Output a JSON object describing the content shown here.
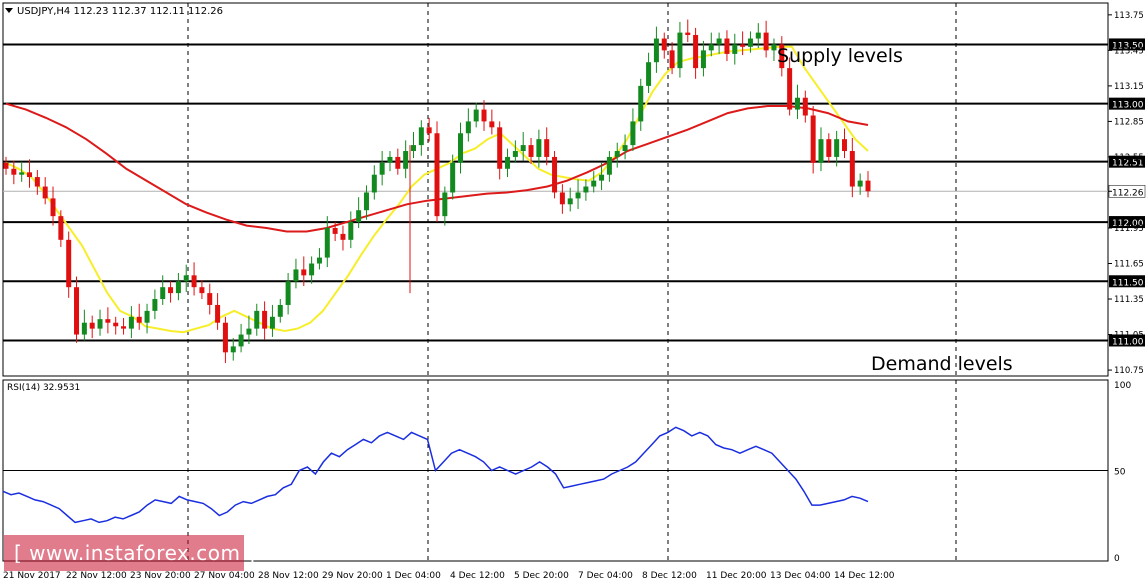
{
  "header": {
    "symbol_line": "USDJPY,H4  112.23 112.37 112.11 112.26",
    "menu_icon": "triangle-down-icon"
  },
  "annotations": {
    "supply": "Supply levels",
    "demand": "Demand levels"
  },
  "indicator": {
    "label": "RSI(14) 32.9531"
  },
  "watermark": "[ www.instaforex.com ]",
  "colors": {
    "bull": "#138a1f",
    "bear": "#e01010",
    "ma_fast": "#f7ee2a",
    "ma_slow": "#dd1a1a",
    "rsi": "#1a2ee0",
    "grid": "#000000"
  },
  "chart_data": [
    {
      "type": "candlestick",
      "symbol": "USDJPY",
      "timeframe": "H4",
      "ylim": [
        110.7,
        113.85
      ],
      "y_ticks": [
        "113.75",
        "113.45",
        "113.15",
        "112.85",
        "112.55",
        "112.26",
        "111.95",
        "111.65",
        "111.35",
        "111.05",
        "110.75"
      ],
      "x_labels": [
        "21 Nov 2017",
        "22 Nov 12:00",
        "23 Nov 20:00",
        "27 Nov 04:00",
        "28 Nov 12:00",
        "29 Nov 20:00",
        "1 Dec 04:00",
        "4 Dec 12:00",
        "5 Dec 20:00",
        "7 Dec 04:00",
        "8 Dec 12:00",
        "11 Dec 20:00",
        "13 Dec 04:00",
        "14 Dec 12:00"
      ],
      "horizontal_levels": [
        {
          "value": 113.5,
          "label": "113.50"
        },
        {
          "value": 113.0,
          "label": "113.00"
        },
        {
          "value": 112.51,
          "label": "112.51"
        },
        {
          "value": 112.0,
          "label": "112.00"
        },
        {
          "value": 111.5,
          "label": "111.50"
        },
        {
          "value": 111.0,
          "label": "111.00"
        }
      ],
      "current_price": {
        "value": 112.26,
        "label": "112.26"
      },
      "close_series": [
        112.45,
        112.4,
        112.42,
        112.38,
        112.3,
        112.2,
        112.05,
        111.85,
        111.45,
        111.05,
        111.15,
        111.1,
        111.18,
        111.15,
        111.12,
        111.1,
        111.2,
        111.15,
        111.25,
        111.35,
        111.45,
        111.4,
        111.5,
        111.55,
        111.45,
        111.4,
        111.3,
        111.15,
        110.9,
        110.95,
        111.05,
        111.1,
        111.25,
        111.1,
        111.2,
        111.3,
        111.5,
        111.6,
        111.55,
        111.65,
        111.7,
        111.95,
        111.9,
        111.85,
        112.0,
        112.1,
        112.25,
        112.4,
        112.5,
        112.55,
        112.45,
        112.6,
        112.65,
        112.8,
        112.75,
        112.05,
        112.25,
        112.5,
        112.75,
        112.85,
        112.95,
        112.85,
        112.8,
        112.45,
        112.55,
        112.6,
        112.65,
        112.55,
        112.7,
        112.55,
        112.25,
        112.15,
        112.2,
        112.25,
        112.3,
        112.35,
        112.4,
        112.55,
        112.6,
        112.65,
        112.85,
        113.15,
        113.35,
        113.55,
        113.45,
        113.3,
        113.6,
        113.58,
        113.3,
        113.45,
        113.5,
        113.55,
        113.42,
        113.5,
        113.48,
        113.55,
        113.6,
        113.45,
        113.5,
        113.3,
        112.95,
        113.05,
        112.9,
        112.5,
        112.7,
        112.55,
        112.7,
        112.6,
        112.3,
        112.35,
        112.26
      ],
      "series": [
        {
          "name": "",
          "style": "ma_fast",
          "values": [
            112.5,
            112.45,
            112.38,
            112.25,
            112.1,
            111.95,
            111.8,
            111.6,
            111.4,
            111.25,
            111.2,
            111.12,
            111.1,
            111.08,
            111.07,
            111.1,
            111.13,
            111.2,
            111.25,
            111.2,
            111.15,
            111.1,
            111.08,
            111.1,
            111.15,
            111.25,
            111.4,
            111.55,
            111.72,
            111.88,
            112.02,
            112.15,
            112.3,
            112.4,
            112.45,
            112.5,
            112.58,
            112.62,
            112.7,
            112.75,
            112.65,
            112.55,
            112.45,
            112.4,
            112.38,
            112.36,
            112.35,
            112.42,
            112.55,
            112.7,
            112.9,
            113.1,
            113.25,
            113.35,
            113.38,
            113.4,
            113.42,
            113.44,
            113.45,
            113.46,
            113.47,
            113.48,
            113.48,
            113.3,
            113.15,
            113.0,
            112.85,
            112.7,
            112.6
          ]
        },
        {
          "name": "",
          "style": "ma_slow",
          "values": [
            113.0,
            112.95,
            112.88,
            112.8,
            112.7,
            112.58,
            112.45,
            112.35,
            112.25,
            112.15,
            112.08,
            112.02,
            111.97,
            111.95,
            111.92,
            111.92,
            111.95,
            112.0,
            112.05,
            112.1,
            112.15,
            112.18,
            112.2,
            112.22,
            112.24,
            112.25,
            112.27,
            112.3,
            112.35,
            112.42,
            112.5,
            112.6,
            112.66,
            112.72,
            112.78,
            112.85,
            112.92,
            112.96,
            112.98,
            112.98,
            112.96,
            112.92,
            112.85,
            112.82
          ]
        }
      ]
    },
    {
      "type": "line",
      "title": "RSI(14) 32.9531",
      "ylim": [
        0,
        100
      ],
      "y_ticks": [
        "100",
        "50",
        "0"
      ],
      "levels": [
        50
      ],
      "series": [
        {
          "name": "",
          "values": [
            38,
            36,
            37,
            35,
            33,
            32,
            30,
            28,
            24,
            20,
            21,
            22,
            20,
            21,
            23,
            22,
            24,
            26,
            30,
            33,
            32,
            31,
            35,
            33,
            32,
            31,
            28,
            24,
            26,
            30,
            32,
            31,
            33,
            35,
            36,
            40,
            42,
            50,
            52,
            48,
            55,
            60,
            58,
            62,
            65,
            68,
            66,
            70,
            72,
            70,
            68,
            72,
            70,
            68,
            50,
            55,
            60,
            62,
            60,
            58,
            55,
            50,
            52,
            50,
            48,
            50,
            52,
            55,
            52,
            48,
            40,
            41,
            42,
            43,
            44,
            45,
            48,
            50,
            52,
            55,
            60,
            65,
            70,
            72,
            75,
            73,
            70,
            72,
            70,
            65,
            63,
            62,
            60,
            62,
            64,
            62,
            60,
            55,
            50,
            45,
            38,
            30,
            30,
            31,
            32,
            33,
            35,
            34,
            32
          ]
        }
      ]
    }
  ]
}
